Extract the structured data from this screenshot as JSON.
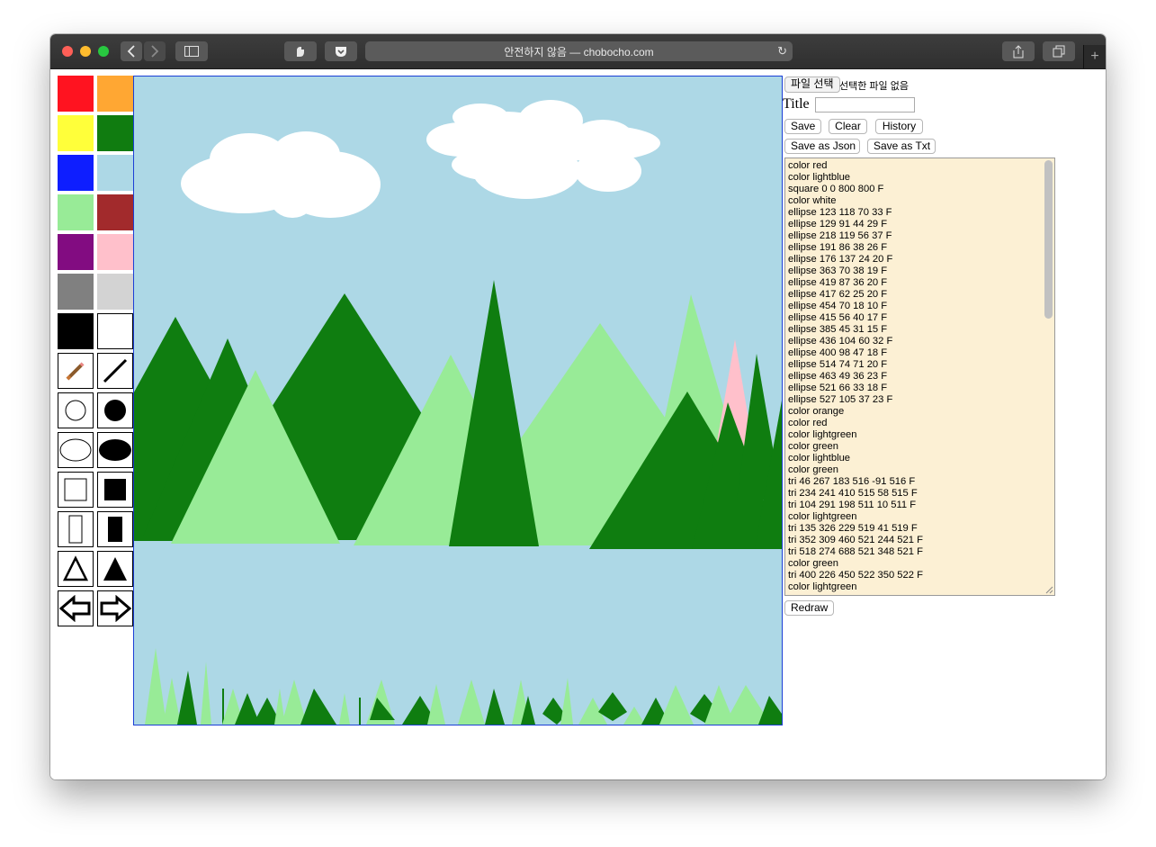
{
  "browser": {
    "url_text": "안전하지 않음 — chobocho.com",
    "new_tab_symbol": "+",
    "nav_icons": [
      "back-icon",
      "forward-icon",
      "sidebar-icon",
      "privacy-icon",
      "pocket-icon",
      "reload-icon",
      "share-icon",
      "tabs-icon"
    ]
  },
  "palette": {
    "colors": [
      "#ff1320",
      "#ffa733",
      "#ffff3a",
      "#107c10",
      "#0e1eff",
      "#add8e6",
      "#98eb97",
      "#a22a2c",
      "#820c81",
      "#ffc0cb",
      "#808080",
      "#d3d3d3",
      "#000000",
      "#ffffff"
    ],
    "tools": [
      "pencil-icon",
      "line-icon",
      "circle-outline-icon",
      "circle-filled-icon",
      "ellipse-outline-icon",
      "ellipse-filled-icon",
      "square-outline-icon",
      "square-filled-icon",
      "rectangle-outline-icon",
      "rectangle-filled-icon",
      "triangle-outline-icon",
      "triangle-filled-icon",
      "undo-arrow-icon",
      "redo-arrow-icon"
    ]
  },
  "panel": {
    "file_button": "파일 선택",
    "file_status": "선택한 파일 없음",
    "title_label": "Title",
    "title_value": "",
    "save_label": "Save",
    "clear_label": "Clear",
    "history_label": "History",
    "save_json_label": "Save as Json",
    "save_txt_label": "Save as Txt",
    "redraw_label": "Redraw",
    "script_lines": [
      "color red",
      "color lightblue",
      "square 0 0 800 800 F",
      "color white",
      "ellipse 123 118 70 33 F",
      "ellipse 129 91 44 29 F",
      "ellipse 218 119 56 37 F",
      "ellipse 191 86 38 26 F",
      "ellipse 176 137 24 20 F",
      "ellipse 363 70 38 19 F",
      "ellipse 419 87 36 20 F",
      "ellipse 417 62 25 20 F",
      "ellipse 454 70 18 10 F",
      "ellipse 415 56 40 17 F",
      "ellipse 385 45 31 15 F",
      "ellipse 436 104 60 32 F",
      "ellipse 400 98 47 18 F",
      "ellipse 514 74 71 20 F",
      "ellipse 463 49 36 23 F",
      "ellipse 521 66 33 18 F",
      "ellipse 527 105 37 23 F",
      "color orange",
      "color red",
      "color lightgreen",
      "color green",
      "color lightblue",
      "color green",
      "tri 46 267 183 516 -91 516 F",
      "tri 234 241 410 515 58 515 F",
      "tri 104 291 198 511 10 511 F",
      "color lightgreen",
      "tri 135 326 229 519 41 519 F",
      "tri 352 309 460 521 244 521 F",
      "tri 518 274 688 521 348 521 F",
      "color green",
      "tri 400 226 450 522 350 522 F",
      "color lightgreen"
    ]
  },
  "scene": {
    "sky_color": "#add8e6",
    "cloud_color": "#ffffff",
    "dark_green": "#0f7d10",
    "light_green": "#98eb97",
    "pink": "#ffc0cb"
  }
}
